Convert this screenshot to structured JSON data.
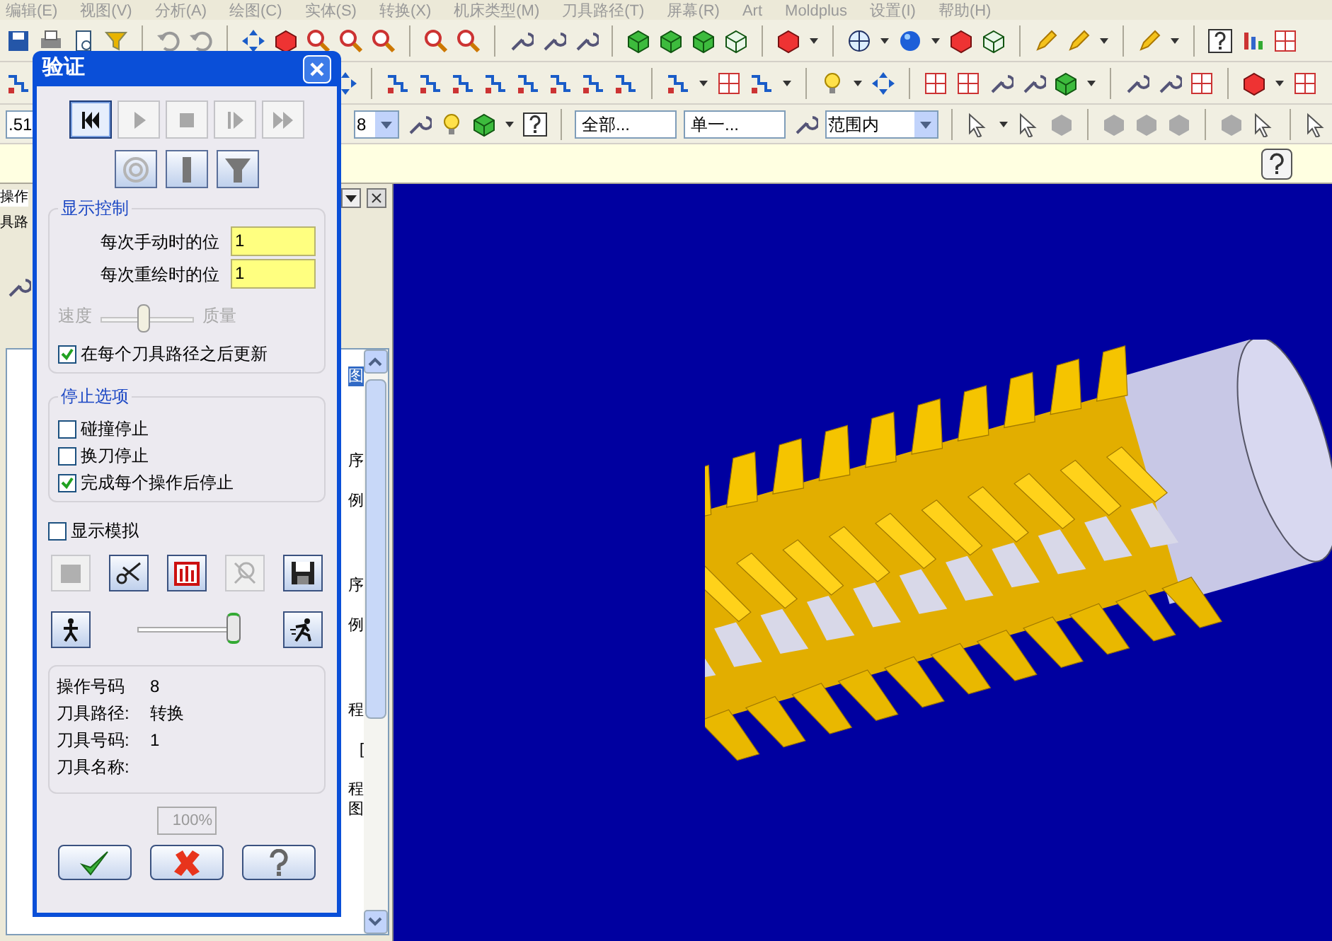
{
  "menu_bar": {
    "items": [
      "编辑(E)",
      "视图(V)",
      "分析(A)",
      "绘图(C)",
      "实体(S)",
      "转换(X)",
      "机床类型(M)",
      "刀具路径(T)",
      "屏幕(R)",
      "Art",
      "Moldplus",
      "设置(I)",
      "帮助(H)"
    ]
  },
  "toolbar_fields": [
    {
      "kind": "combo",
      "value": ".51"
    },
    {
      "kind": "combo",
      "value": "8"
    },
    {
      "kind": "text",
      "value": "全部..."
    },
    {
      "kind": "text",
      "value": "单一..."
    },
    {
      "kind": "combo",
      "value": "范围内"
    }
  ],
  "left_panel": {
    "tab": "操作",
    "header": "具路",
    "tree_fragments": [
      {
        "text": "图",
        "selected": true
      },
      {
        "text": "序",
        "selected": false
      },
      {
        "text": "例",
        "selected": false
      },
      {
        "text": "序",
        "selected": false
      },
      {
        "text": "例",
        "selected": false
      },
      {
        "text": "程",
        "selected": false
      },
      {
        "text": "[",
        "selected": false
      },
      {
        "text": "程",
        "selected": false
      },
      {
        "text": "图",
        "selected": false
      }
    ]
  },
  "dialog": {
    "title": "验证",
    "playback_buttons": [
      {
        "selected": true,
        "disabled": false
      },
      {
        "selected": false,
        "disabled": true
      },
      {
        "selected": false,
        "disabled": true
      },
      {
        "selected": false,
        "disabled": true
      },
      {
        "selected": false,
        "disabled": true
      }
    ],
    "view_buttons": [
      {
        "disabled": true
      },
      {
        "disabled": false
      },
      {
        "disabled": false
      }
    ],
    "display_group": {
      "title": "显示控制",
      "fields": [
        {
          "label": "每次手动时的位",
          "value": "1"
        },
        {
          "label": "每次重绘时的位",
          "value": "1"
        }
      ],
      "slider": {
        "left_label": "速度",
        "right_label": "质量",
        "level": 0.45,
        "disabled": true
      },
      "update_checkbox": {
        "label": "在每个刀具路径之后更新",
        "checked": true
      }
    },
    "stop_group": {
      "title": "停止选项",
      "checkboxes": [
        {
          "label": "碰撞停止",
          "checked": false
        },
        {
          "label": "换刀停止",
          "checked": false
        },
        {
          "label": "完成每个操作后停止",
          "checked": true
        }
      ]
    },
    "simulate_checkbox": {
      "label": "显示模拟",
      "checked": false
    },
    "option_buttons": [
      {
        "disabled": true
      },
      {
        "disabled": false
      },
      {
        "disabled": false
      },
      {
        "disabled": true
      },
      {
        "disabled": false
      }
    ],
    "speed_slider": {
      "level": 1
    },
    "info": [
      {
        "label": "操作号码",
        "value": "8"
      },
      {
        "label": "刀具路径:",
        "value": "转换"
      },
      {
        "label": "刀具号码:",
        "value": "1"
      },
      {
        "label": "刀具名称:"
      }
    ],
    "progress_text": "100%"
  }
}
